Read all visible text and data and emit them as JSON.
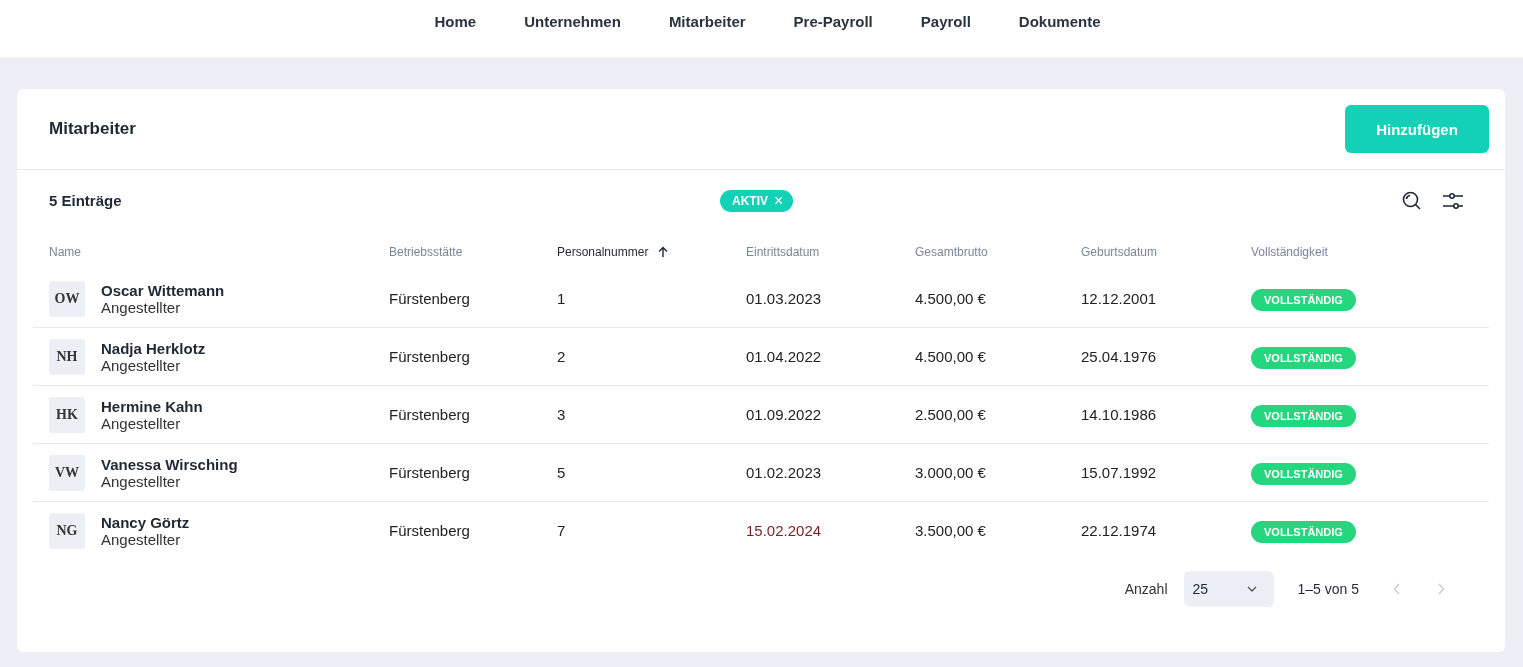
{
  "nav": [
    {
      "label": "Home"
    },
    {
      "label": "Unternehmen"
    },
    {
      "label": "Mitarbeiter"
    },
    {
      "label": "Pre-Payroll"
    },
    {
      "label": "Payroll"
    },
    {
      "label": "Dokumente"
    }
  ],
  "card": {
    "title": "Mitarbeiter",
    "add_button": "Hinzufügen"
  },
  "toolbar": {
    "count": "5 Einträge",
    "filter_chip": "AKTIV",
    "chip_close": "×"
  },
  "columns": [
    {
      "label": "Name",
      "sorted": false
    },
    {
      "label": "Betriebsstätte",
      "sorted": false
    },
    {
      "label": "Personalnummer",
      "sorted": true
    },
    {
      "label": "Eintrittsdatum",
      "sorted": false
    },
    {
      "label": "Gesamtbrutto",
      "sorted": false
    },
    {
      "label": "Geburtsdatum",
      "sorted": false
    },
    {
      "label": "Vollständigkeit",
      "sorted": false
    }
  ],
  "rows": [
    {
      "initials": "OW",
      "name": "Oscar Wittemann",
      "role": "Angestellter",
      "site": "Fürstenberg",
      "number": "1",
      "entry_date": "01.03.2023",
      "entry_future": false,
      "gross": "4.500,00 €",
      "birth_date": "12.12.2001",
      "status": "VOLLSTÄNDIG"
    },
    {
      "initials": "NH",
      "name": "Nadja Herklotz",
      "role": "Angestellter",
      "site": "Fürstenberg",
      "number": "2",
      "entry_date": "01.04.2022",
      "entry_future": false,
      "gross": "4.500,00 €",
      "birth_date": "25.04.1976",
      "status": "VOLLSTÄNDIG"
    },
    {
      "initials": "HK",
      "name": "Hermine Kahn",
      "role": "Angestellter",
      "site": "Fürstenberg",
      "number": "3",
      "entry_date": "01.09.2022",
      "entry_future": false,
      "gross": "2.500,00 €",
      "birth_date": "14.10.1986",
      "status": "VOLLSTÄNDIG"
    },
    {
      "initials": "VW",
      "name": "Vanessa Wirsching",
      "role": "Angestellter",
      "site": "Fürstenberg",
      "number": "5",
      "entry_date": "01.02.2023",
      "entry_future": false,
      "gross": "3.000,00 €",
      "birth_date": "15.07.1992",
      "status": "VOLLSTÄNDIG"
    },
    {
      "initials": "NG",
      "name": "Nancy Görtz",
      "role": "Angestellter",
      "site": "Fürstenberg",
      "number": "7",
      "entry_date": "15.02.2024",
      "entry_future": true,
      "gross": "3.500,00 €",
      "birth_date": "22.12.1974",
      "status": "VOLLSTÄNDIG"
    }
  ],
  "pagination": {
    "label": "Anzahl",
    "page_size": "25",
    "range": "1–5 von 5",
    "prev_disabled": true,
    "next_disabled": true
  }
}
